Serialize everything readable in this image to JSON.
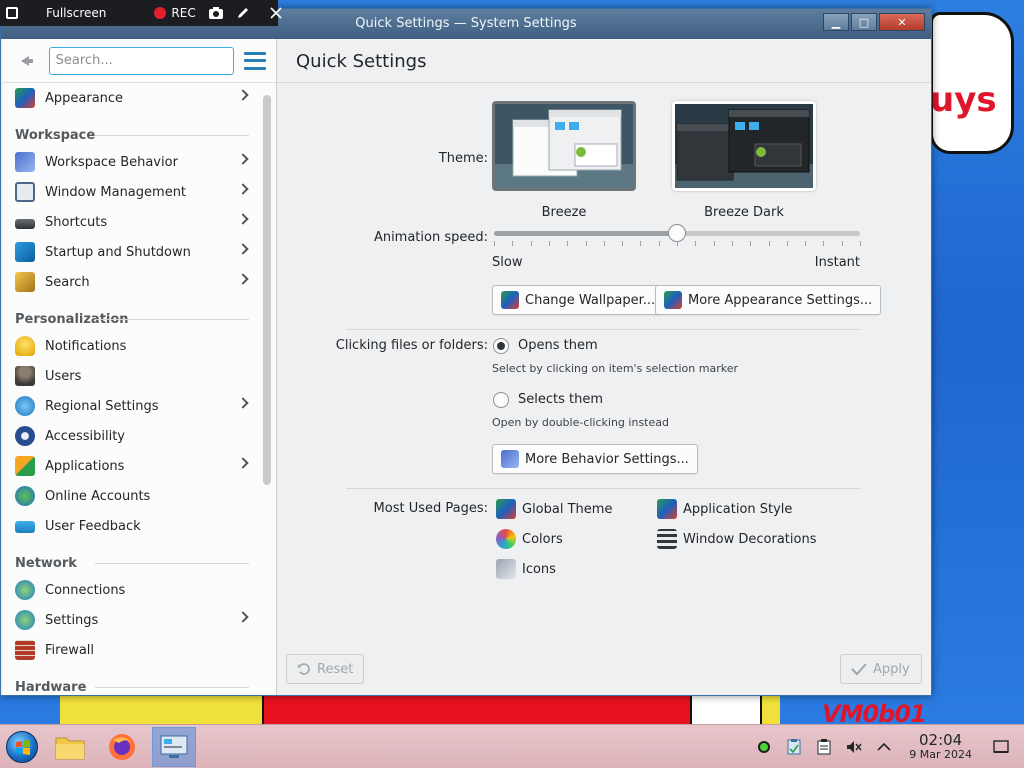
{
  "recording_bar": {
    "fullscreen_label": "Fullscreen",
    "rec_label": "REC"
  },
  "window": {
    "title": "Quick Settings — System Settings",
    "controls": {
      "minimize": "▁",
      "maximize": "□",
      "close": "✕"
    }
  },
  "sidebar": {
    "search_placeholder": "Search...",
    "top_items": [
      {
        "label": "Appearance",
        "icon": "appearance-icon",
        "has_children": true
      }
    ],
    "sections": [
      {
        "title": "Workspace",
        "items": [
          {
            "label": "Workspace Behavior",
            "icon": "workspace-behavior-icon",
            "has_children": true
          },
          {
            "label": "Window Management",
            "icon": "window-management-icon",
            "has_children": true
          },
          {
            "label": "Shortcuts",
            "icon": "keyboard-icon",
            "has_children": true
          },
          {
            "label": "Startup and Shutdown",
            "icon": "startup-shutdown-icon",
            "has_children": true
          },
          {
            "label": "Search",
            "icon": "search-icon",
            "has_children": true
          }
        ]
      },
      {
        "title": "Personalization",
        "items": [
          {
            "label": "Notifications",
            "icon": "bell-icon",
            "has_children": false
          },
          {
            "label": "Users",
            "icon": "users-icon",
            "has_children": false
          },
          {
            "label": "Regional Settings",
            "icon": "globe-icon",
            "has_children": true
          },
          {
            "label": "Accessibility",
            "icon": "accessibility-icon",
            "has_children": false
          },
          {
            "label": "Applications",
            "icon": "applications-icon",
            "has_children": true
          },
          {
            "label": "Online Accounts",
            "icon": "online-accounts-icon",
            "has_children": false
          },
          {
            "label": "User Feedback",
            "icon": "user-feedback-icon",
            "has_children": false
          }
        ]
      },
      {
        "title": "Network",
        "items": [
          {
            "label": "Connections",
            "icon": "network-connections-icon",
            "has_children": false
          },
          {
            "label": "Settings",
            "icon": "network-settings-icon",
            "has_children": true
          },
          {
            "label": "Firewall",
            "icon": "firewall-icon",
            "has_children": false
          }
        ]
      },
      {
        "title": "Hardware",
        "items": []
      }
    ]
  },
  "main": {
    "page_title": "Quick Settings",
    "theme_label": "Theme:",
    "themes": [
      {
        "name": "Breeze",
        "selected": true
      },
      {
        "name": "Breeze Dark",
        "selected": false
      }
    ],
    "animation_label": "Animation speed:",
    "animation_min_label": "Slow",
    "animation_max_label": "Instant",
    "animation_value": 0.5,
    "change_wallpaper_label": "Change Wallpaper...",
    "more_appearance_label": "More Appearance Settings...",
    "clicking_label": "Clicking files or folders:",
    "option_open_label": "Opens them",
    "option_open_hint": "Select by clicking on item's selection marker",
    "option_select_label": "Selects them",
    "option_select_hint": "Open by double-clicking instead",
    "selected_option": "open",
    "more_behavior_label": "More Behavior Settings...",
    "most_used_label": "Most Used Pages:",
    "most_used": [
      {
        "label": "Global Theme",
        "icon": "global-theme-icon"
      },
      {
        "label": "Application Style",
        "icon": "application-style-icon"
      },
      {
        "label": "Colors",
        "icon": "colors-icon"
      },
      {
        "label": "Window Decorations",
        "icon": "window-decorations-icon"
      },
      {
        "label": "Icons",
        "icon": "icons-icon"
      }
    ],
    "reset_label": "Reset",
    "apply_label": "Apply"
  },
  "taskbar": {
    "clock_time": "02:04",
    "clock_date": "9 Mar 2024"
  },
  "desktop": {
    "blob_text": "uys",
    "watermark": "VM0b01"
  },
  "colors": {
    "accent": "#3daee9",
    "titlebar": "#4a6b8e",
    "desktop": "#1e66d0",
    "taskbar": "#e0bcc1"
  }
}
